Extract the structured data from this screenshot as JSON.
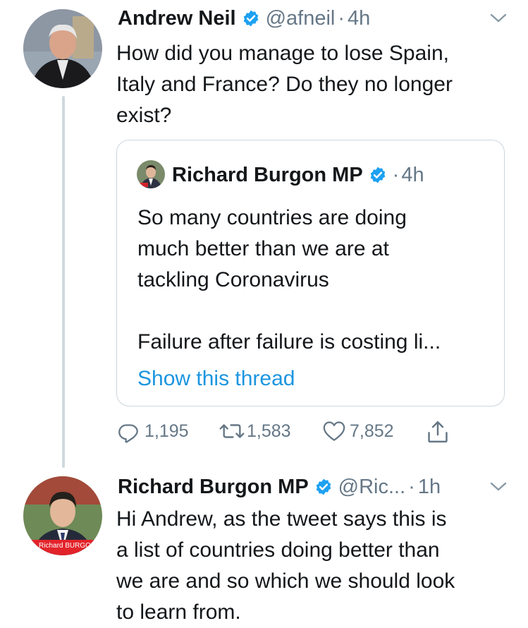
{
  "tweet1": {
    "name": "Andrew Neil",
    "handle": "@afneil",
    "sep": "·",
    "time": "4h",
    "text_lines": [
      "How did you manage to lose Spain,",
      "Italy and France? Do they no longer",
      "exist?"
    ]
  },
  "quote": {
    "name": "Richard Burgon MP",
    "sep": "·",
    "time": "4h",
    "text_lines": [
      "So many countries are doing",
      "much better than we are at",
      "tackling Coronavirus"
    ],
    "text_line2": "Failure after failure is costing li...",
    "show_thread": "Show this thread"
  },
  "actions": {
    "replies": "1,195",
    "retweets": "1,583",
    "likes": "7,852"
  },
  "tweet2": {
    "name": "Richard Burgon MP",
    "handle": "@Ric...",
    "sep": "·",
    "time": "1h",
    "avatar_banner": "Richard BURGON",
    "text_lines": [
      "Hi Andrew, as the tweet says this is",
      "a list of countries doing better than",
      "we are and so which we should look",
      "to learn from."
    ]
  },
  "colors": {
    "verified": "#1da1f2",
    "link": "#1b95e0",
    "muted": "#657786",
    "thread_line": "#cfd9de"
  }
}
